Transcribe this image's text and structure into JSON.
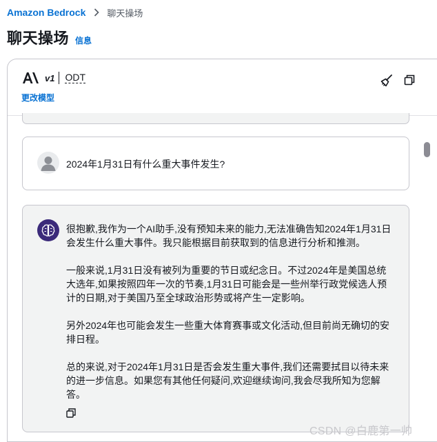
{
  "breadcrumb": {
    "root": "Amazon Bedrock",
    "current": "聊天操场"
  },
  "header": {
    "title": "聊天操场",
    "info": "信息"
  },
  "model": {
    "version_mark": "v1",
    "name": "ODT",
    "change_label": "更改模型"
  },
  "chat": {
    "user_message": "2024年1月31日有什么重大事件发生?",
    "ai_paragraphs": [
      "很抱歉,我作为一个AI助手,没有预知未来的能力,无法准确告知2024年1月31日会发生什么重大事件。我只能根据目前获取到的信息进行分析和推测。",
      "一般来说,1月31日没有被列为重要的节日或纪念日。不过2024年是美国总统大选年,如果按照四年一次的节奏,1月31日可能会是一些州举行政党候选人预计的日期,对于美国乃至全球政治形势或将产生一定影响。",
      "另外2024年也可能会发生一些重大体育赛事或文化活动,但目前尚无确切的安排日程。",
      "总的来说,对于2024年1月31日是否会发生重大事件,我们还需要拭目以待未来的进一步信息。如果您有其他任何疑问,欢迎继续询问,我会尽我所知为您解答。"
    ]
  },
  "icons": {
    "breadcrumb_separator": "chevron-right-icon",
    "provider_logo": "anthropic-logo",
    "clear_chat": "broom-icon",
    "copy": "copy-icon",
    "user_avatar": "user-avatar-icon",
    "ai_avatar": "brain-icon"
  },
  "colors": {
    "link": "#0972d3",
    "ai_card_bg": "#f2f3f3",
    "ai_avatar_bg": "#3b2a7a",
    "border": "#c6c6cd"
  },
  "watermark": "CSDN @白鹿第一帅"
}
